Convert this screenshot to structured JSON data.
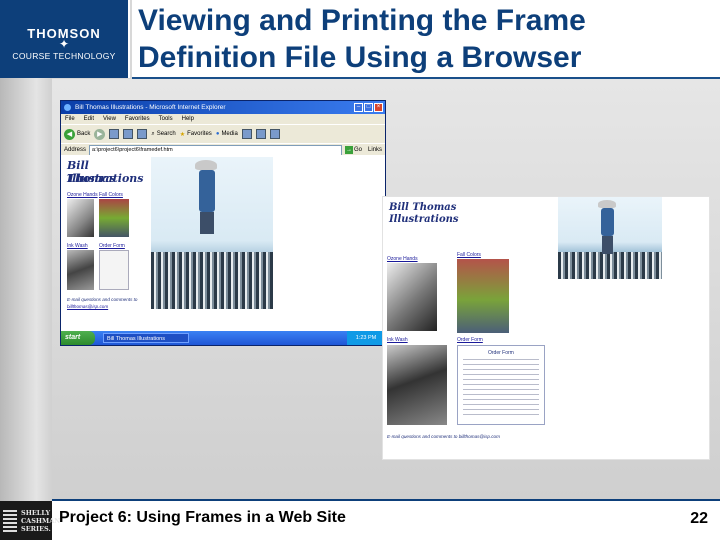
{
  "logo": {
    "line1": "THOMSON",
    "star": "✦",
    "line2": "COURSE TECHNOLOGY"
  },
  "slide": {
    "title": "Viewing and Printing the Frame Definition File Using a Browser"
  },
  "browser": {
    "window_title": "Bill Thomas Illustrations - Microsoft Internet Explorer",
    "menu": [
      "File",
      "Edit",
      "View",
      "Favorites",
      "Tools",
      "Help"
    ],
    "toolbar": {
      "back": "Back",
      "search": "Search",
      "favorites": "Favorites",
      "media": "Media"
    },
    "address_label": "Address",
    "address_value": "a:\\project6\\project6\\framedef.htm",
    "go_label": "Go",
    "links_label": "Links",
    "taskbar": {
      "start": "start",
      "task": "Bill Thomas Illustrations",
      "clock": "1:23 PM"
    }
  },
  "webpage": {
    "brand_line1": "Bill Thomas",
    "brand_line2": "Illustrations",
    "thumbs": [
      "Ozone Hands",
      "Fall Colors",
      "Ink Wash",
      "Order Form"
    ],
    "contact_line1": "E-mail questions and comments to",
    "contact_line2": "billthomas@isp.com"
  },
  "printout": {
    "brand_line1": "Bill Thomas",
    "brand_line2": "Illustrations",
    "thumbs": [
      "Ozone Hands",
      "Fall Colors",
      "Ink Wash",
      "Order Form"
    ],
    "form_heading": "Order Form",
    "contact_line": "E-mail questions and comments to billthomas@isp.com"
  },
  "footer": {
    "text": "Project 6: Using Frames in a Web Site",
    "page_number": "22"
  },
  "publisher_mark": {
    "line1": "SHELLY",
    "line2": "CASHMAN",
    "line3": "SERIES."
  },
  "colors": {
    "brand_blue": "#0d3f7a",
    "xp_blue": "#1f56d6",
    "start_green": "#3aa13a"
  }
}
